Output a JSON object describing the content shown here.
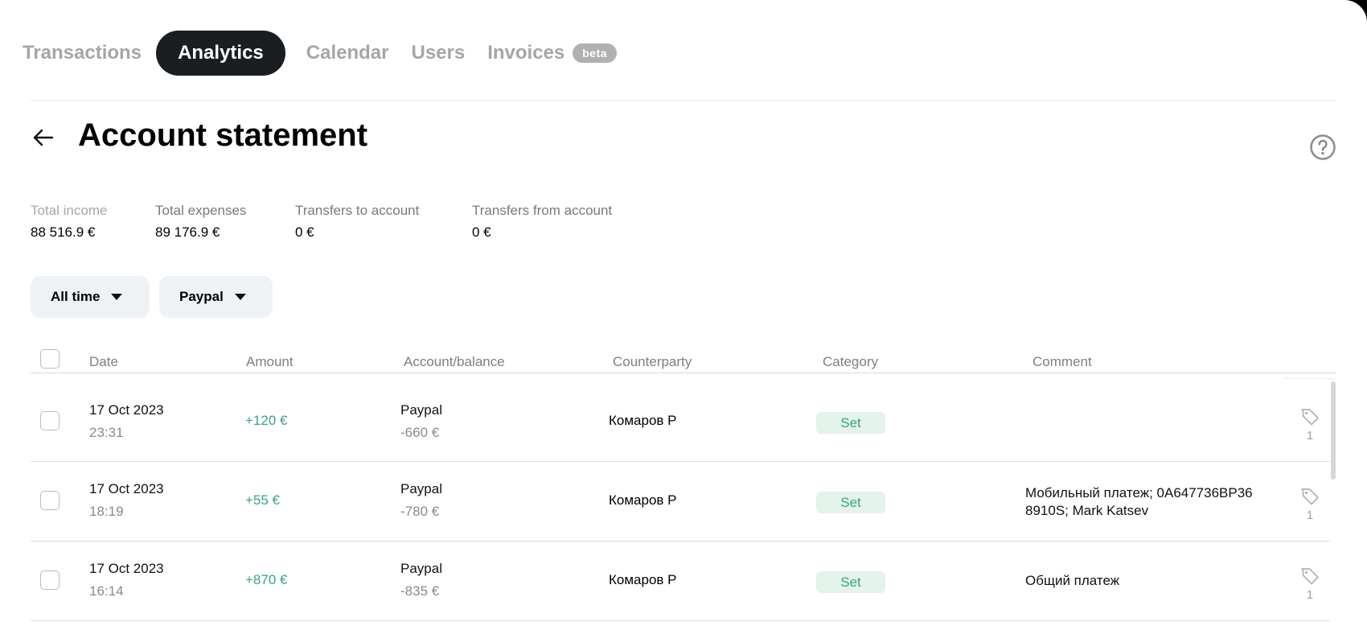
{
  "tabs": [
    {
      "label": "Transactions"
    },
    {
      "label": "Analytics"
    },
    {
      "label": "Calendar"
    },
    {
      "label": "Users"
    },
    {
      "label": "Invoices",
      "badge": "beta"
    }
  ],
  "header": {
    "title": "Account statement"
  },
  "summary": [
    {
      "label": "Total income",
      "value": "88 516.9 €"
    },
    {
      "label": "Total expenses",
      "value": "89 176.9 €"
    },
    {
      "label": "Transfers to account",
      "value": "0 €"
    },
    {
      "label": "Transfers from account",
      "value": "0 €"
    }
  ],
  "filters": {
    "period": "All time",
    "account": "Paypal"
  },
  "table": {
    "columns": [
      "Date",
      "Amount",
      "Account/balance",
      "Counterparty",
      "Category",
      "Comment"
    ],
    "rows": [
      {
        "date": "17 Oct 2023",
        "time": "23:31",
        "amount": "+120 €",
        "account": "Paypal",
        "balance": "-660 €",
        "counterparty": "Комаров Р",
        "category": "Set",
        "comment": "",
        "tags": "1"
      },
      {
        "date": "17 Oct 2023",
        "time": "18:19",
        "amount": "+55 €",
        "account": "Paypal",
        "balance": "-780 €",
        "counterparty": "Комаров Р",
        "category": "Set",
        "comment": "Мобильный платеж; 0A647736BP36 8910S; Mark Katsev",
        "tags": "1"
      },
      {
        "date": "17 Oct 2023",
        "time": "16:14",
        "amount": "+870 €",
        "account": "Paypal",
        "balance": "-835 €",
        "counterparty": "Комаров Р",
        "category": "Set",
        "comment": "Общий платеж",
        "tags": "1"
      }
    ]
  },
  "colors": {
    "accent": "#1b1e21",
    "positive": "#3aa57c",
    "pill_bg": "#e4f3ec",
    "filter_bg": "#eff2f5"
  },
  "icons": {
    "back": "arrow-left-icon",
    "help": "question-circle-icon",
    "tag": "tag-icon",
    "caret": "caret-down-icon"
  }
}
